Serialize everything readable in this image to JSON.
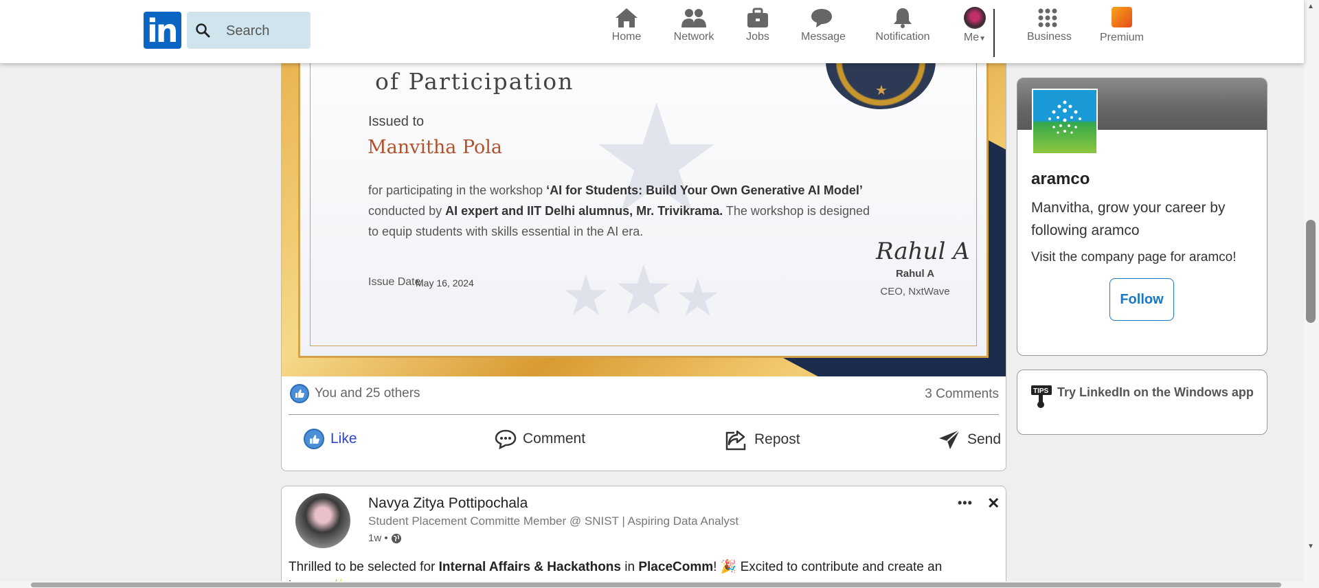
{
  "nav": {
    "logo_text": "in",
    "search_placeholder": "Search",
    "items": [
      {
        "label": "Home",
        "icon": "home-icon"
      },
      {
        "label": "Network",
        "icon": "network-icon"
      },
      {
        "label": "Jobs",
        "icon": "briefcase-icon"
      },
      {
        "label": "Message",
        "icon": "message-icon"
      },
      {
        "label": "Notification",
        "icon": "bell-icon"
      },
      {
        "label": "Me",
        "icon": "avatar"
      },
      {
        "label": "Business",
        "icon": "grid-icon"
      },
      {
        "label": "Premium",
        "icon": "premium-icon"
      }
    ]
  },
  "post": {
    "certificate": {
      "subtitle": "of Participation",
      "issued_label": "Issued to",
      "recipient": "Manvitha Pola",
      "body_1": "for participating in the workshop ",
      "body_bold_1": "‘AI for Students: Build Your Own Generative AI Model’",
      "body_2": "conducted by ",
      "body_bold_2": "AI expert and IIT Delhi alumnus, Mr. Trivikrama.",
      "body_3": " The workshop is designed",
      "body_4": "to equip students with skills essential in the AI era.",
      "issue_date_label": "Issue Date:",
      "issue_date": "May 16, 2024",
      "signature": "Rahul A",
      "signer_name": "Rahul A",
      "signer_title": "CEO, NxtWave"
    },
    "reactions_text": "You and 25 others",
    "comments_text": "3 Comments",
    "actions": {
      "like": "Like",
      "comment": "Comment",
      "repost": "Repost",
      "send": "Send"
    }
  },
  "post2": {
    "author": "Navya Zitya Pottipochala",
    "headline": "Student Placement Committe Member @ SNIST | Aspiring Data Analyst",
    "time": "1w •",
    "text_1": "Thrilled to be selected for ",
    "text_bold_1": "Internal Affairs & Hackathons",
    "text_2": " in ",
    "text_bold_2": "PlaceComm",
    "text_3": "! 🎉 Excited to contribute and create an",
    "text_line2": "impact ✨"
  },
  "ad": {
    "company": "aramco",
    "grow_text": "Manvitha, grow your career by following aramco",
    "visit_text": "Visit the company page for aramco!",
    "follow_label": "Follow"
  },
  "tip": {
    "icon_text": "TIPS",
    "text": "Try LinkedIn on the Windows app"
  },
  "colors": {
    "brand": "#0a66c2",
    "follow": "#1977c3",
    "like_active": "#2b44d6"
  }
}
